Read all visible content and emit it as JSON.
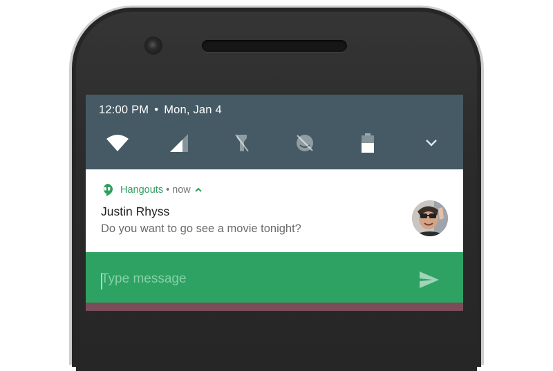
{
  "status": {
    "time": "12:00 PM",
    "separator": "•",
    "date": "Mon, Jan 4"
  },
  "quick_settings": [
    {
      "icon": "wifi-icon"
    },
    {
      "icon": "cellular-signal-icon"
    },
    {
      "icon": "flashlight-off-icon"
    },
    {
      "icon": "auto-rotate-off-icon"
    },
    {
      "icon": "battery-icon"
    },
    {
      "icon": "expand-chevron-icon"
    }
  ],
  "notification": {
    "app_name": "Hangouts",
    "separator": "•",
    "time": "now",
    "title": "Justin Rhyss",
    "text": "Do you want to go see a movie tonight?",
    "accent_color": "#2e9f5c"
  },
  "reply": {
    "placeholder": "Type message",
    "bar_color": "#2ea263"
  },
  "colors": {
    "quick_settings_bg": "#455a64",
    "phone_body": "#262626"
  }
}
